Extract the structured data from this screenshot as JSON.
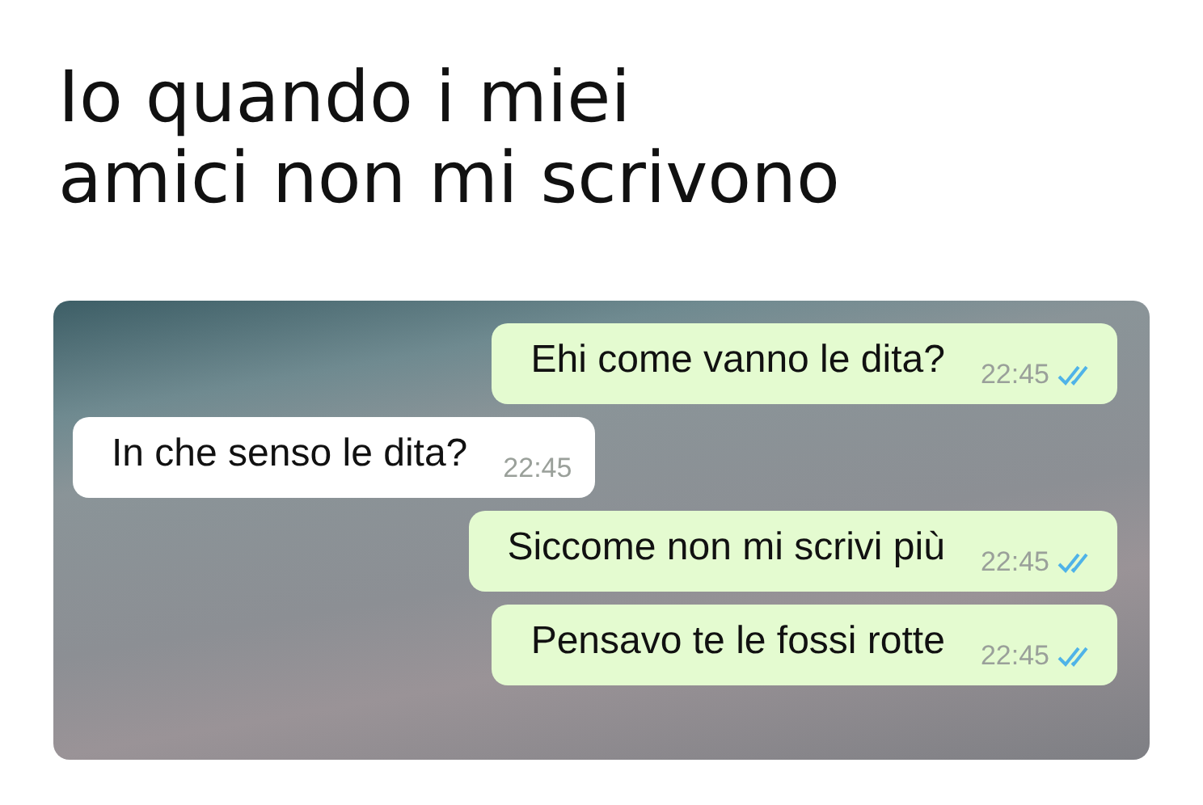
{
  "caption": "Io quando i miei\namici non mi scrivono",
  "chat": {
    "messages": [
      {
        "kind": "outgoing",
        "text": "Ehi come vanno le dita?",
        "time": "22:45",
        "read": true
      },
      {
        "kind": "incoming",
        "text": "In che senso le dita?",
        "time": "22:45"
      },
      {
        "kind": "outgoing",
        "text": "Siccome non mi scrivi più",
        "time": "22:45",
        "read": true
      },
      {
        "kind": "outgoing",
        "text": "Pensavo te le fossi rotte",
        "time": "22:45",
        "read": true
      }
    ]
  }
}
